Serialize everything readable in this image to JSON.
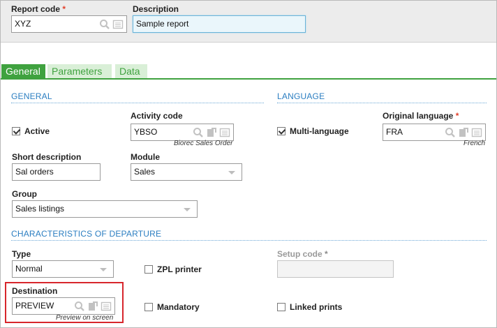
{
  "header": {
    "report_code_label": "Report code",
    "report_code_value": "XYZ",
    "description_label": "Description",
    "description_value": "Sample report",
    "required_mark": "*"
  },
  "tabs": [
    {
      "label": "General",
      "active": true
    },
    {
      "label": "Parameters",
      "active": false
    },
    {
      "label": "Data",
      "active": false
    }
  ],
  "general": {
    "section_title": "GENERAL",
    "active_label": "Active",
    "active_checked": true,
    "activity_code_label": "Activity code",
    "activity_code_value": "YBSO",
    "activity_code_desc": "Biorec Sales Order",
    "short_desc_label": "Short description",
    "short_desc_value": "Sal orders",
    "module_label": "Module",
    "module_value": "Sales",
    "group_label": "Group",
    "group_value": "Sales listings"
  },
  "language": {
    "section_title": "LANGUAGE",
    "multi_label": "Multi-language",
    "multi_checked": true,
    "orig_lang_label": "Original language",
    "orig_lang_value": "FRA",
    "orig_lang_desc": "French"
  },
  "departure": {
    "section_title": "CHARACTERISTICS OF DEPARTURE",
    "type_label": "Type",
    "type_value": "Normal",
    "zpl_label": "ZPL printer",
    "zpl_checked": false,
    "setup_code_label": "Setup code",
    "destination_label": "Destination",
    "destination_value": "PREVIEW",
    "destination_desc": "Preview on screen",
    "mandatory_label": "Mandatory",
    "mandatory_checked": false,
    "linked_label": "Linked prints",
    "linked_checked": false
  },
  "colors": {
    "accent_green": "#3fa23f",
    "section_blue": "#2b7ec1",
    "required_red": "#e2402b",
    "highlight_red": "#d7262c"
  },
  "icons": [
    "search-icon",
    "list-icon",
    "goto-icon"
  ]
}
